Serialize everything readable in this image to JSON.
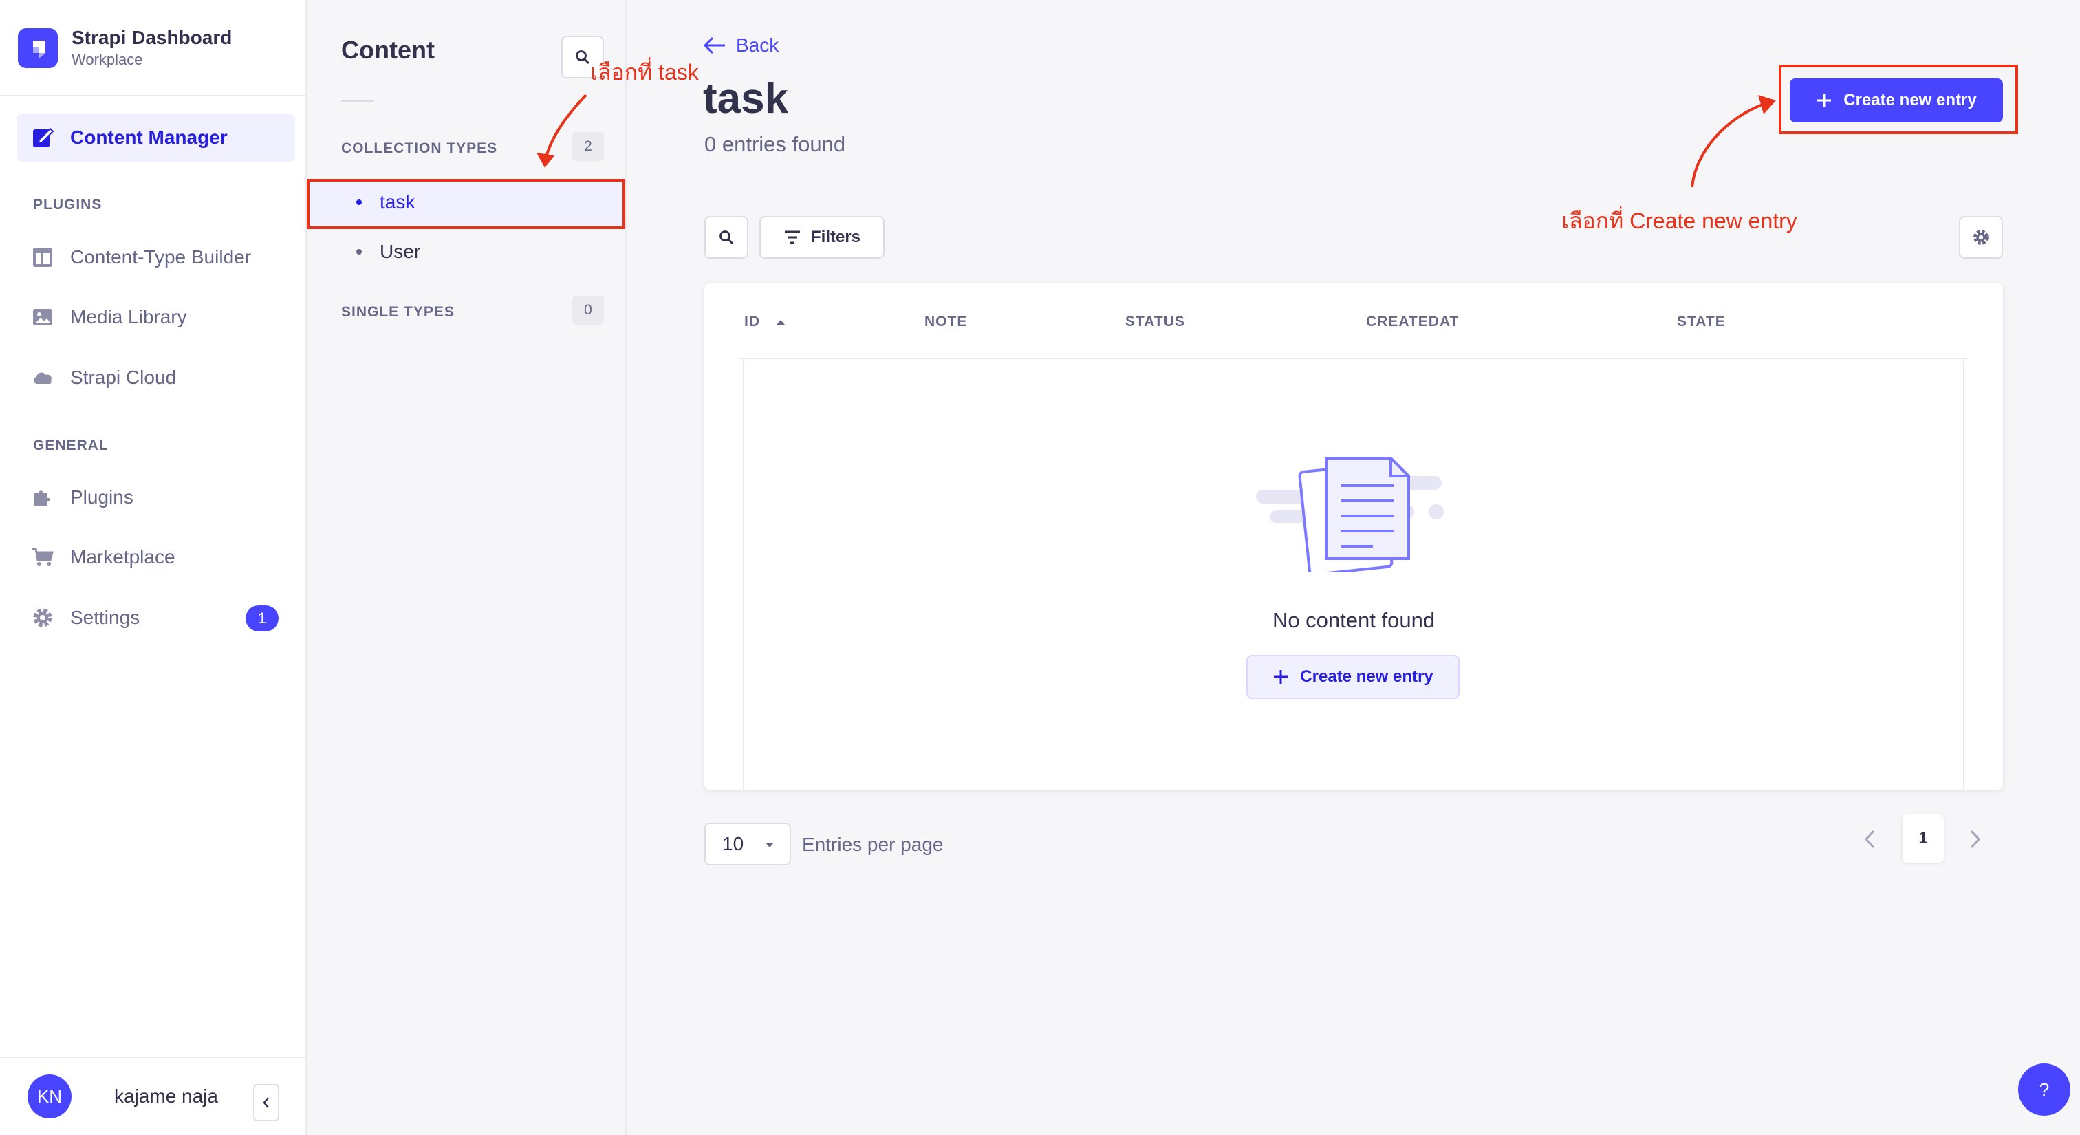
{
  "brand": {
    "title": "Strapi Dashboard",
    "subtitle": "Workplace"
  },
  "mainnav": {
    "content_manager": "Content Manager",
    "plugins_section": "PLUGINS",
    "plugins_items": [
      "Content-Type Builder",
      "Media Library",
      "Strapi Cloud"
    ],
    "general_section": "GENERAL",
    "general_items": [
      "Plugins",
      "Marketplace",
      "Settings"
    ],
    "settings_badge": "1"
  },
  "user": {
    "initials": "KN",
    "name": "kajame naja"
  },
  "subnav": {
    "title": "Content",
    "collection_types_label": "COLLECTION TYPES",
    "collection_types_count": "2",
    "collection_types": [
      "task",
      "User"
    ],
    "single_types_label": "SINGLE TYPES",
    "single_types_count": "0"
  },
  "main": {
    "back": "Back",
    "title": "task",
    "entries_found": "0 entries found",
    "create_button": "Create new entry",
    "filters_button": "Filters",
    "columns": [
      "ID",
      "NOTE",
      "STATUS",
      "CREATEDAT",
      "STATE"
    ],
    "empty_message": "No content found",
    "empty_create_button": "Create new entry",
    "per_page_value": "10",
    "per_page_label": "Entries per page",
    "current_page": "1",
    "help": "?"
  },
  "annotations": {
    "select_task": "เลือกที่ task",
    "select_create": "เลือกที่ Create new entry",
    "color": "#e8321a"
  },
  "colors": {
    "primary": "#4945ff",
    "active_bg": "#f0f0ff",
    "active_text": "#271fe0"
  }
}
